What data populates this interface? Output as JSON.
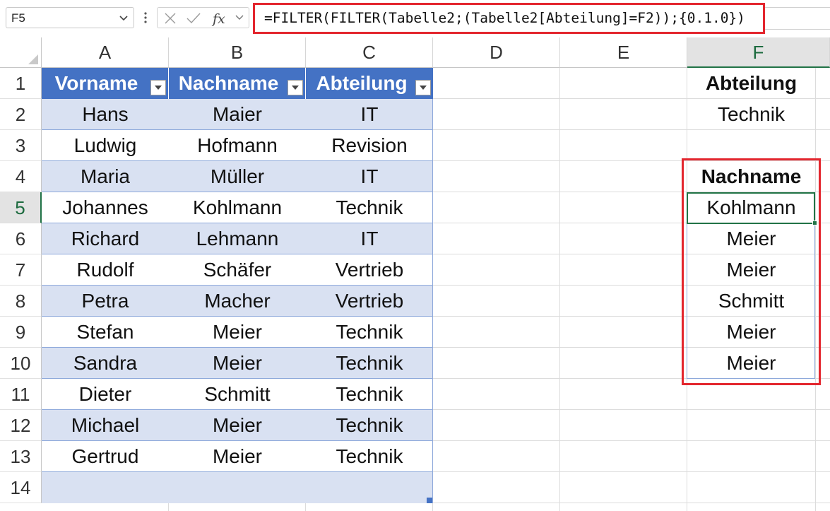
{
  "formula_bar": {
    "name_box": "F5",
    "formula": "=FILTER(FILTER(Tabelle2;(Tabelle2[Abteilung]=F2));{0.1.0})"
  },
  "columns": [
    "A",
    "B",
    "C",
    "D",
    "E",
    "F"
  ],
  "active_column": "F",
  "rows": [
    "1",
    "2",
    "3",
    "4",
    "5",
    "6",
    "7",
    "8",
    "9",
    "10",
    "11",
    "12",
    "13",
    "14"
  ],
  "active_row": "5",
  "table": {
    "headers": [
      "Vorname",
      "Nachname",
      "Abteilung"
    ],
    "rows": [
      [
        "Hans",
        "Maier",
        "IT"
      ],
      [
        "Ludwig",
        "Hofmann",
        "Revision"
      ],
      [
        "Maria",
        "Müller",
        "IT"
      ],
      [
        "Johannes",
        "Kohlmann",
        "Technik"
      ],
      [
        "Richard",
        "Lehmann",
        "IT"
      ],
      [
        "Rudolf",
        "Schäfer",
        "Vertrieb"
      ],
      [
        "Petra",
        "Macher",
        "Vertrieb"
      ],
      [
        "Stefan",
        "Meier",
        "Technik"
      ],
      [
        "Sandra",
        "Meier",
        "Technik"
      ],
      [
        "Dieter",
        "Schmitt",
        "Technik"
      ],
      [
        "Michael",
        "Meier",
        "Technik"
      ],
      [
        "Gertrud",
        "Meier",
        "Technik"
      ]
    ]
  },
  "criteria": {
    "label": "Abteilung",
    "value": "Technik"
  },
  "result": {
    "header": "Nachname",
    "values": [
      "Kohlmann",
      "Meier",
      "Meier",
      "Schmitt",
      "Meier",
      "Meier"
    ]
  },
  "colors": {
    "table_header": "#4472c4",
    "table_band": "#d9e1f2",
    "highlight": "#e3262e",
    "selection": "#217346"
  }
}
